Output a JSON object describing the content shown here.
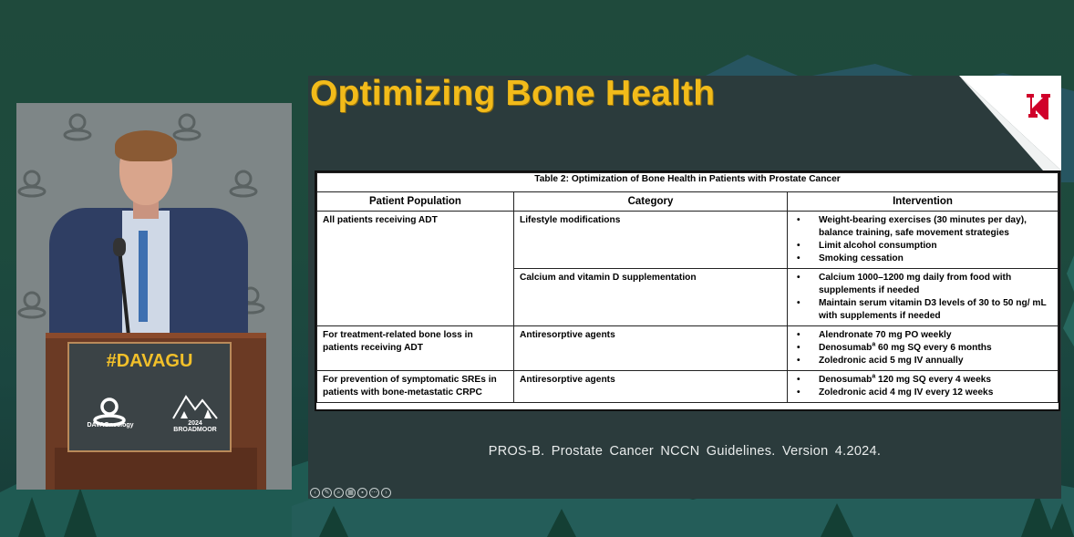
{
  "slide": {
    "title": "Optimizing Bone Health",
    "table": {
      "caption": "Table 2: Optimization of Bone Health in Patients with Prostate Cancer",
      "columns": [
        "Patient Population",
        "Category",
        "Intervention"
      ],
      "row1": {
        "population": "All patients receiving ADT",
        "category_a": "Lifestyle modifications",
        "interventions_a": [
          "Weight-bearing exercises (30 minutes per day), balance training, safe movement strategies",
          "Limit alcohol consumption",
          "Smoking cessation"
        ],
        "category_b": "Calcium and vitamin D supplementation",
        "interventions_b": [
          "Calcium 1000–1200 mg daily from food with supplements if needed",
          "Maintain serum vitamin D3 levels of 30 to 50 ng/ mL with supplements if needed"
        ]
      },
      "row2": {
        "population": "For treatment-related bone loss in patients receiving ADT",
        "category": "Antiresorptive agents",
        "int_1": "Alendronate 70 mg PO weekly",
        "int_2_drug": "Denosumab",
        "int_2_sup": "a",
        "int_2_rest": " 60 mg SQ every 6 months",
        "int_3": "Zoledronic acid 5 mg IV annually"
      },
      "row3": {
        "population": "For prevention of symptomatic SREs in patients with bone-metastatic CRPC",
        "category": "Antiresorptive agents",
        "int_1_drug": "Denosumab",
        "int_1_sup": "a",
        "int_1_rest": " 120 mg SQ every 4 weeks",
        "int_2": "Zoledronic acid 4 mg IV every 12 weeks"
      }
    },
    "footer": "PROS-B.  Prostate Cancer NCCN Guidelines.  Version 4.2024."
  },
  "podium": {
    "hashtag": "#DAVAGU",
    "org_logo_text": "DAVAOncology",
    "event_text": "2024 BROADMOOR"
  },
  "toolbar": {
    "icons": [
      "previous-icon",
      "pen-icon",
      "zoom-icon",
      "grid-icon",
      "video-icon",
      "more-icon",
      "next-icon"
    ]
  },
  "colors": {
    "title": "#f2bb1a",
    "slide_bg": "#2b3b3c",
    "background": "#1f4a3c",
    "logo_red": "#d0002a"
  }
}
